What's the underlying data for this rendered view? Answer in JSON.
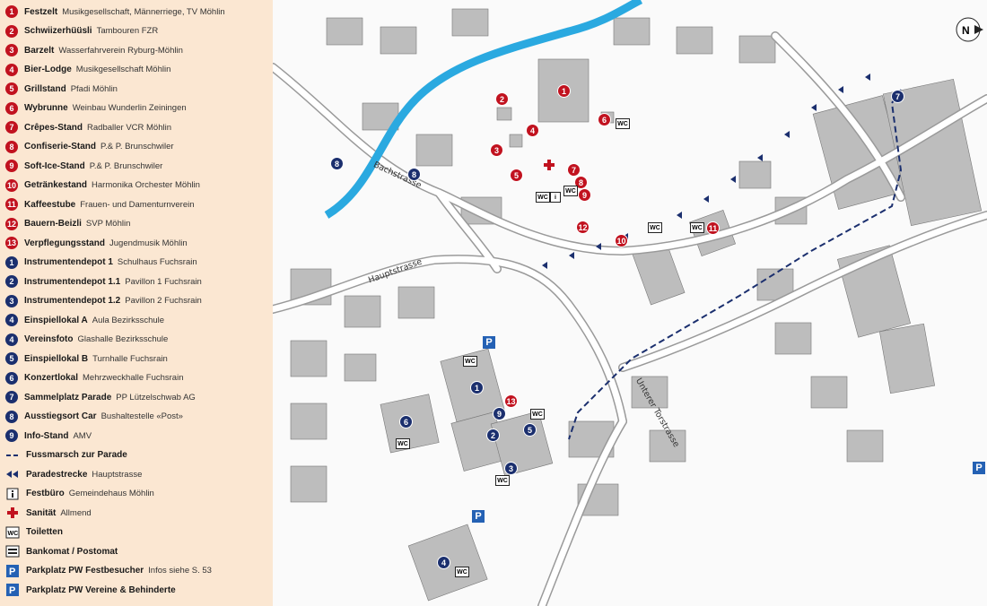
{
  "legend": {
    "items": [
      {
        "num": "1",
        "color": "red",
        "label": "Festzelt",
        "desc": "Musikgesellschaft, Männerriege, TV Möhlin"
      },
      {
        "num": "2",
        "color": "red",
        "label": "Schwiizerhüüsli",
        "desc": "Tambouren FZR"
      },
      {
        "num": "3",
        "color": "red",
        "label": "Barzelt",
        "desc": "Wasserfahrverein Ryburg-Möhlin"
      },
      {
        "num": "4",
        "color": "red",
        "label": "Bier-Lodge",
        "desc": "Musikgesellschaft Möhlin"
      },
      {
        "num": "5",
        "color": "red",
        "label": "Grillstand",
        "desc": "Pfadi Möhlin"
      },
      {
        "num": "6",
        "color": "red",
        "label": "Wybrunne",
        "desc": "Weinbau Wunderlin Zeiningen"
      },
      {
        "num": "7",
        "color": "red",
        "label": "Crêpes-Stand",
        "desc": "Radballer VCR Möhlin"
      },
      {
        "num": "8",
        "color": "red",
        "label": "Confiserie-Stand",
        "desc": "P.& P. Brunschwiler"
      },
      {
        "num": "9",
        "color": "red",
        "label": "Soft-Ice-Stand",
        "desc": "P.& P. Brunschwiler"
      },
      {
        "num": "10",
        "color": "red",
        "label": "Getränkestand",
        "desc": "Harmonika Orchester Möhlin"
      },
      {
        "num": "11",
        "color": "red",
        "label": "Kaffeestube",
        "desc": "Frauen- und Damenturnverein"
      },
      {
        "num": "12",
        "color": "red",
        "label": "Bauern-Beizli",
        "desc": "SVP Möhlin"
      },
      {
        "num": "13",
        "color": "red",
        "label": "Verpflegungsstand",
        "desc": "Jugendmusik Möhlin"
      },
      {
        "num": "1",
        "color": "blue",
        "label": "Instrumentendepot 1",
        "desc": "Schulhaus Fuchsrain"
      },
      {
        "num": "2",
        "color": "blue",
        "label": "Instrumentendepot 1.1",
        "desc": "Pavillon 1 Fuchsrain"
      },
      {
        "num": "3",
        "color": "blue",
        "label": "Instrumentendepot 1.2",
        "desc": "Pavillon 2 Fuchsrain"
      },
      {
        "num": "4",
        "color": "blue",
        "label": "Einspiellokal A",
        "desc": "Aula Bezirksschule"
      },
      {
        "num": "4",
        "color": "blue",
        "label": "Vereinsfoto",
        "desc": "Glashalle Bezirksschule"
      },
      {
        "num": "5",
        "color": "blue",
        "label": "Einspiellokal B",
        "desc": "Turnhalle Fuchsrain"
      },
      {
        "num": "6",
        "color": "blue",
        "label": "Konzertlokal",
        "desc": "Mehrzweckhalle Fuchsrain"
      },
      {
        "num": "7",
        "color": "blue",
        "label": "Sammelplatz Parade",
        "desc": "PP Lützelschwab AG"
      },
      {
        "num": "8",
        "color": "blue",
        "label": "Ausstiegsort Car",
        "desc": "Bushaltestelle «Post»"
      },
      {
        "num": "9",
        "color": "blue",
        "label": "Info-Stand",
        "desc": "AMV"
      }
    ],
    "symbols": [
      {
        "icon": "dashed-line-icon",
        "label": "Fussmarsch zur Parade",
        "desc": ""
      },
      {
        "icon": "arrow-left-icon",
        "label": "Paradestrecke",
        "desc": "Hauptstrasse"
      },
      {
        "icon": "info-icon",
        "label": "Festbüro",
        "desc": "Gemeindehaus Möhlin"
      },
      {
        "icon": "red-cross-icon",
        "label": "Sanität",
        "desc": "Allmend"
      },
      {
        "icon": "wc-icon",
        "label": "Toiletten",
        "desc": ""
      },
      {
        "icon": "atm-icon",
        "label": "Bankomat / Postomat",
        "desc": ""
      },
      {
        "icon": "parking-icon",
        "label": "Parkplatz PW Festbesucher",
        "desc": "Infos siehe S. 53"
      },
      {
        "icon": "parking-icon",
        "label": "Parkplatz PW Vereine & Behinderte",
        "desc": ""
      }
    ]
  },
  "map": {
    "streets": [
      "Bachstrasse",
      "Hauptstrasse",
      "Unterer Torstrasse"
    ],
    "north_label": "N",
    "wc_text": "WC",
    "parking_text": "P",
    "info_text": "i",
    "red_markers": [
      "1",
      "2",
      "3",
      "4",
      "5",
      "6",
      "7",
      "8",
      "9",
      "10",
      "11",
      "12",
      "13"
    ],
    "blue_markers": [
      "1",
      "2",
      "3",
      "4",
      "5",
      "6",
      "7",
      "8",
      "8",
      "9"
    ]
  },
  "colors": {
    "red": "#c1121f",
    "blue": "#1b2f6e",
    "parking": "#2461b4",
    "river": "#2aa9e0",
    "legend_bg": "#fbe7d2"
  }
}
